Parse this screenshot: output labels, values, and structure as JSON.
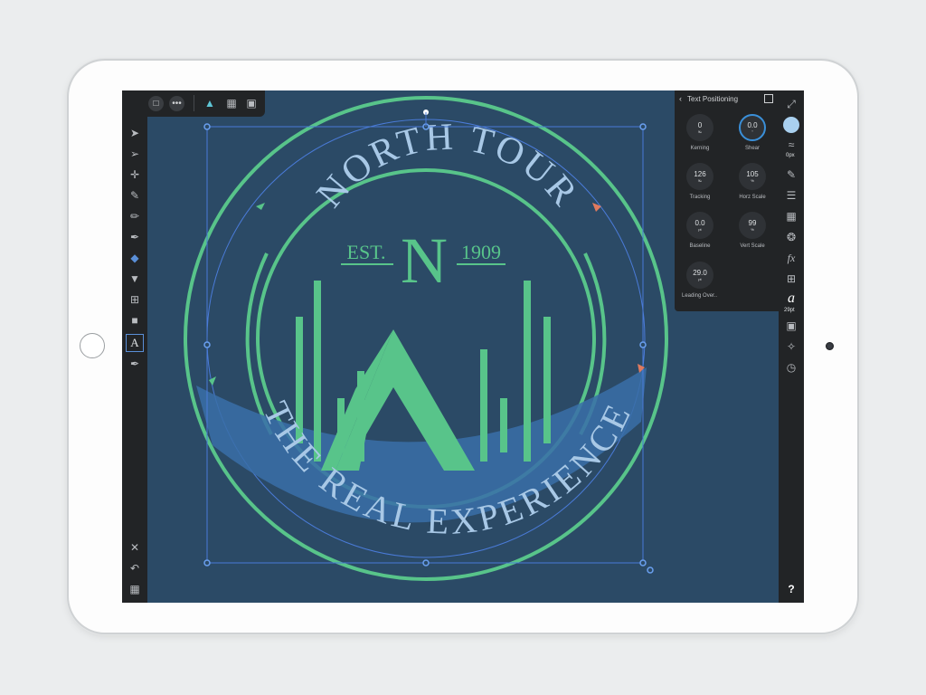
{
  "toolbar": {
    "back_icon": "back-arrow-icon",
    "save_icon": "save-icon",
    "more_icon": "ellipsis-icon",
    "persona_icon": "designer-persona-icon",
    "grid_icon": "grid-icon",
    "view_icon": "view-mode-icon",
    "more_label": "•••"
  },
  "logo": {
    "top_text": "NORTH TOUR",
    "est_label": "EST.",
    "monogram": "N",
    "year": "1909",
    "banner_text": "THE REAL EXPERIENCE"
  },
  "text_positioning": {
    "title": "Text Positioning",
    "back_glyph": "‹",
    "kerning": {
      "value": "0",
      "unit": "‰",
      "label": "Kerning"
    },
    "shear": {
      "value": "0.0",
      "unit": "°",
      "label": "Shear"
    },
    "tracking": {
      "value": "126",
      "unit": "‰",
      "label": "Tracking"
    },
    "horz_scale": {
      "value": "105",
      "unit": "%",
      "label": "Horz Scale"
    },
    "baseline": {
      "value": "0.0",
      "unit": "pt",
      "label": "Baseline"
    },
    "vert_scale": {
      "value": "99",
      "unit": "%",
      "label": "Vert Scale"
    },
    "leading": {
      "value": "29.0",
      "unit": "pt",
      "label": "Leading Over.."
    }
  },
  "right_sidebar": {
    "stroke_width": "0px",
    "font_size": "29pt",
    "help_label": "?"
  },
  "colors": {
    "canvas": "#2b4a66",
    "logo_green": "#58c48a",
    "logo_text": "#a8c8e6",
    "banner": "#3a6ea8",
    "fill_swatch": "#a9d0ef",
    "shear_ring": "#3a8fd8"
  }
}
